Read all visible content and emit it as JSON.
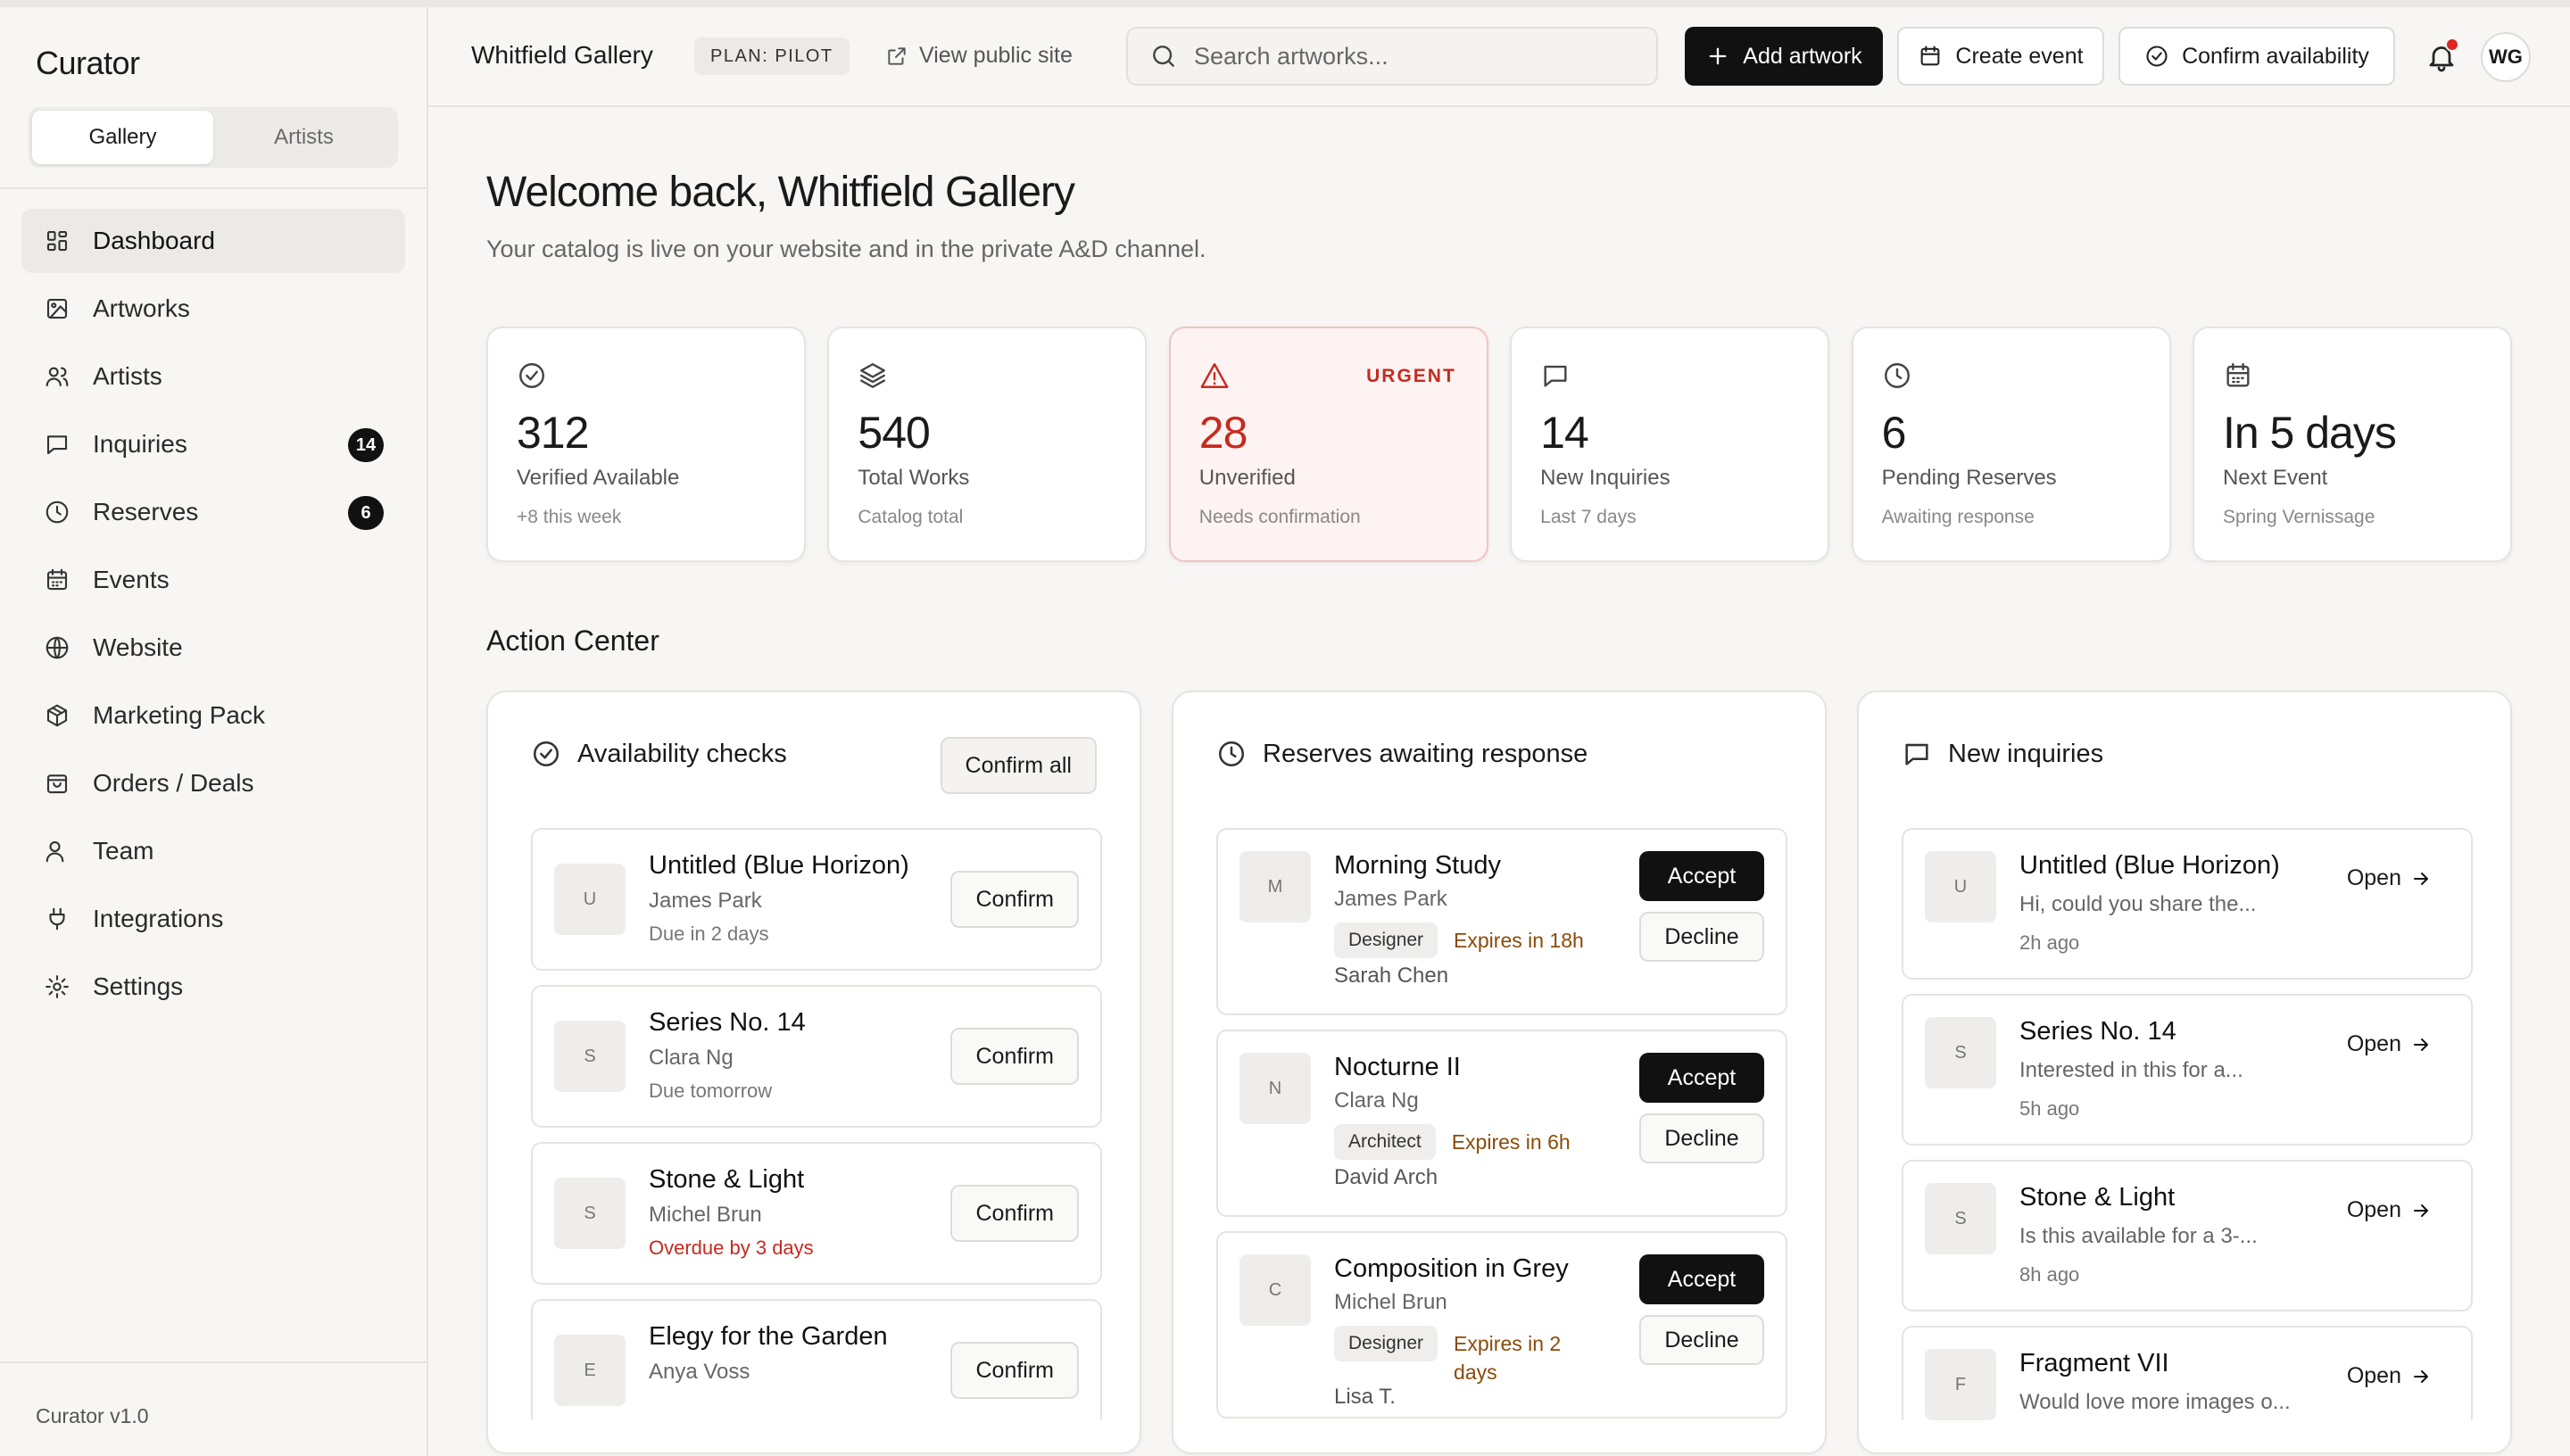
{
  "app": {
    "brand": "Curator",
    "version": "Curator v1.0"
  },
  "switcher": {
    "gallery": "Gallery",
    "artists": "Artists"
  },
  "nav": [
    {
      "label": "Dashboard",
      "icon": "dashboard-icon",
      "badge": ""
    },
    {
      "label": "Artworks",
      "icon": "image-icon",
      "badge": ""
    },
    {
      "label": "Artists",
      "icon": "users-icon",
      "badge": ""
    },
    {
      "label": "Inquiries",
      "icon": "message-icon",
      "badge": "14"
    },
    {
      "label": "Reserves",
      "icon": "clock-icon",
      "badge": "6"
    },
    {
      "label": "Events",
      "icon": "calendar-icon",
      "badge": ""
    },
    {
      "label": "Website",
      "icon": "globe-icon",
      "badge": ""
    },
    {
      "label": "Marketing Pack",
      "icon": "package-icon",
      "badge": ""
    },
    {
      "label": "Orders / Deals",
      "icon": "shopping-bag-icon",
      "badge": ""
    },
    {
      "label": "Team",
      "icon": "user-icon",
      "badge": ""
    },
    {
      "label": "Integrations",
      "icon": "plug-icon",
      "badge": ""
    },
    {
      "label": "Settings",
      "icon": "gear-icon",
      "badge": ""
    }
  ],
  "header": {
    "gallery_name": "Whitfield Gallery",
    "plan": "PLAN: PILOT",
    "view_public": "View public site",
    "search_placeholder": "Search artworks...",
    "add_artwork": "Add artwork",
    "create_event": "Create event",
    "confirm_availability": "Confirm availability",
    "avatar_initials": "WG"
  },
  "main": {
    "welcome": "Welcome back, Whitfield Gallery",
    "subtitle": "Your catalog is live on your website and in the private A&D channel.",
    "action_center": "Action Center"
  },
  "stats": [
    {
      "icon": "check-circle-icon",
      "value": "312",
      "label": "Verified Available",
      "sub": "+8 this week",
      "tag": ""
    },
    {
      "icon": "layers-icon",
      "value": "540",
      "label": "Total Works",
      "sub": "Catalog total",
      "tag": ""
    },
    {
      "icon": "alert-triangle-icon",
      "value": "28",
      "label": "Unverified",
      "sub": "Needs confirmation",
      "tag": "URGENT"
    },
    {
      "icon": "message-icon",
      "value": "14",
      "label": "New Inquiries",
      "sub": "Last 7 days",
      "tag": ""
    },
    {
      "icon": "clock-icon",
      "value": "6",
      "label": "Pending Reserves",
      "sub": "Awaiting response",
      "tag": ""
    },
    {
      "icon": "calendar-icon",
      "value": "In 5 days",
      "label": "Next Event",
      "sub": "Spring Vernissage",
      "tag": ""
    }
  ],
  "availability": {
    "title": "Availability checks",
    "confirm_all": "Confirm all",
    "items": [
      {
        "initial": "U",
        "title": "Untitled (Blue Horizon)",
        "artist": "James Park",
        "due": "Due in 2 days",
        "overdue": false,
        "action": "Confirm"
      },
      {
        "initial": "S",
        "title": "Series No. 14",
        "artist": "Clara Ng",
        "due": "Due tomorrow",
        "overdue": false,
        "action": "Confirm"
      },
      {
        "initial": "S",
        "title": "Stone & Light",
        "artist": "Michel Brun",
        "due": "Overdue by 3 days",
        "overdue": true,
        "action": "Confirm"
      },
      {
        "initial": "E",
        "title": "Elegy for the Garden",
        "artist": "Anya Voss",
        "due": "",
        "overdue": false,
        "action": "Confirm"
      }
    ]
  },
  "reserves": {
    "title": "Reserves awaiting response",
    "items": [
      {
        "initial": "M",
        "title": "Morning Study",
        "artist": "James Park",
        "role": "Designer",
        "expires": "Expires in 18h",
        "contact": "Sarah Chen",
        "accept": "Accept",
        "decline": "Decline"
      },
      {
        "initial": "N",
        "title": "Nocturne II",
        "artist": "Clara Ng",
        "role": "Architect",
        "expires": "Expires in 6h",
        "contact": "David Arch",
        "accept": "Accept",
        "decline": "Decline"
      },
      {
        "initial": "C",
        "title": "Composition in Grey",
        "artist": "Michel Brun",
        "role": "Designer",
        "expires": "Expires in 2 days",
        "contact": "Lisa T.",
        "accept": "Accept",
        "decline": "Decline"
      }
    ]
  },
  "inquiries": {
    "title": "New inquiries",
    "items": [
      {
        "initial": "U",
        "title": "Untitled (Blue Horizon)",
        "message": "Hi, could you share the...",
        "time": "2h ago",
        "action": "Open"
      },
      {
        "initial": "S",
        "title": "Series No. 14",
        "message": "Interested in this for a...",
        "time": "5h ago",
        "action": "Open"
      },
      {
        "initial": "S",
        "title": "Stone & Light",
        "message": "Is this available for a 3-...",
        "time": "8h ago",
        "action": "Open"
      },
      {
        "initial": "F",
        "title": "Fragment VII",
        "message": "Would love more images o...",
        "time": "",
        "action": "Open"
      }
    ]
  },
  "colors": {
    "accent": "#111111",
    "urgent": "#c62a1f",
    "expiry": "#8a4b08",
    "notification_dot": "#e02424"
  }
}
